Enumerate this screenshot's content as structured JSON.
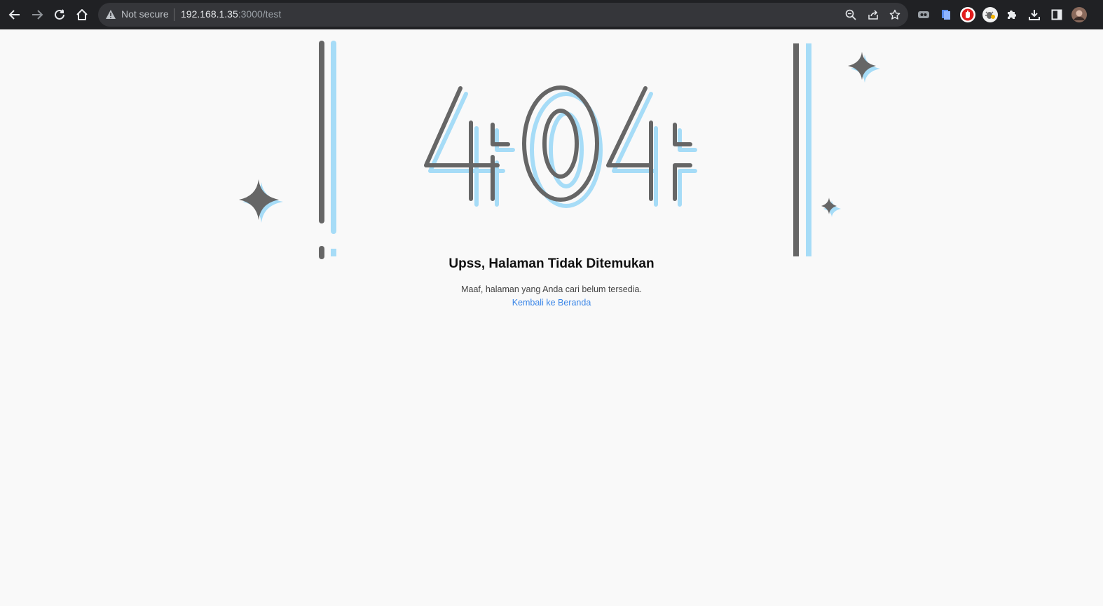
{
  "browser": {
    "security_label": "Not secure",
    "url_host": "192.168.1.35",
    "url_path": ":3000/test",
    "nav_icons": [
      "back-arrow-icon",
      "forward-arrow-icon",
      "reload-icon",
      "home-icon"
    ],
    "omnibox_icons": [
      "zoom-icon",
      "share-icon",
      "bookmark-star-icon"
    ],
    "extension_icons": [
      "tab-group-icon",
      "notes-extension-icon",
      "adblock-icon",
      "bug-extension-icon",
      "extensions-puzzle-icon",
      "download-icon",
      "side-panel-icon",
      "profile-avatar"
    ]
  },
  "error_page": {
    "code": "404",
    "title": "Upss, Halaman Tidak Ditemukan",
    "description": "Maaf, halaman yang Anda cari belum tersedia.",
    "link_label": "Kembali ke Beranda"
  },
  "colors": {
    "chrome_bg": "#202124",
    "omnibox_bg": "#35363a",
    "page_bg": "#f9f9f9",
    "stroke_gray": "#666666",
    "stroke_blue": "#a6dcf7",
    "link_blue": "#3a86e8"
  }
}
